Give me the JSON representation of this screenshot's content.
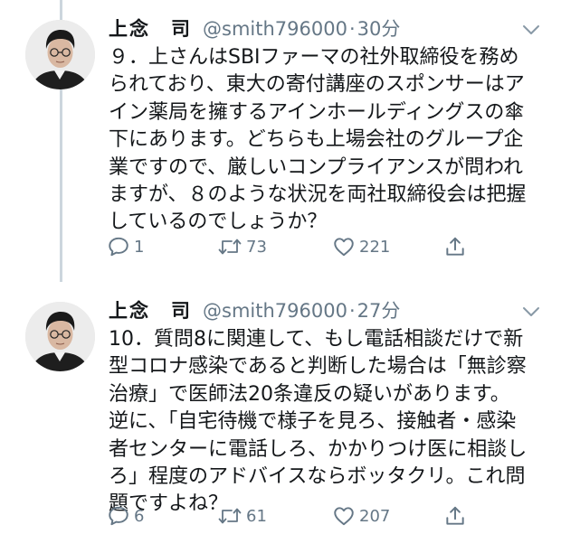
{
  "colors": {
    "text": "#14171a",
    "secondary": "#657786",
    "thread_line": "#ccd6dd"
  },
  "tweets": [
    {
      "author_name": "上念　司",
      "handle": "@smith796000",
      "separator": "·",
      "time": "30分",
      "text": "９．上さんはSBIファーマの社外取締役を務められており、東大の寄付講座のスポンサーはアイン薬局を擁するアインホールディングスの傘下にあります。どちらも上場会社のグループ企業ですので、厳しいコンプライアンスが問われますが、８のような状況を両社取締役会は把握しているのでしょうか？",
      "reply_count": "1",
      "retweet_count": "73",
      "like_count": "221",
      "avatar_icon": "profile-photo-avatar",
      "icons": [
        "reply-icon",
        "retweet-icon",
        "like-icon",
        "share-icon",
        "chevron-down-icon"
      ]
    },
    {
      "author_name": "上念　司",
      "handle": "@smith796000",
      "separator": "·",
      "time": "27分",
      "text": "10．質問8に関連して、もし電話相談だけで新型コロナ感染であると判断した場合は「無診察治療」で医師法20条違反の疑いがあります。\n逆に、「自宅待機で様子を見ろ、接触者・感染者センターに電話しろ、かかりつけ医に相談しろ」程度のアドバイスならボッタクリ。これ問題ですよね？",
      "reply_count": "6",
      "retweet_count": "61",
      "like_count": "207",
      "avatar_icon": "profile-photo-avatar",
      "icons": [
        "reply-icon",
        "retweet-icon",
        "like-icon",
        "share-icon",
        "chevron-down-icon"
      ]
    }
  ]
}
